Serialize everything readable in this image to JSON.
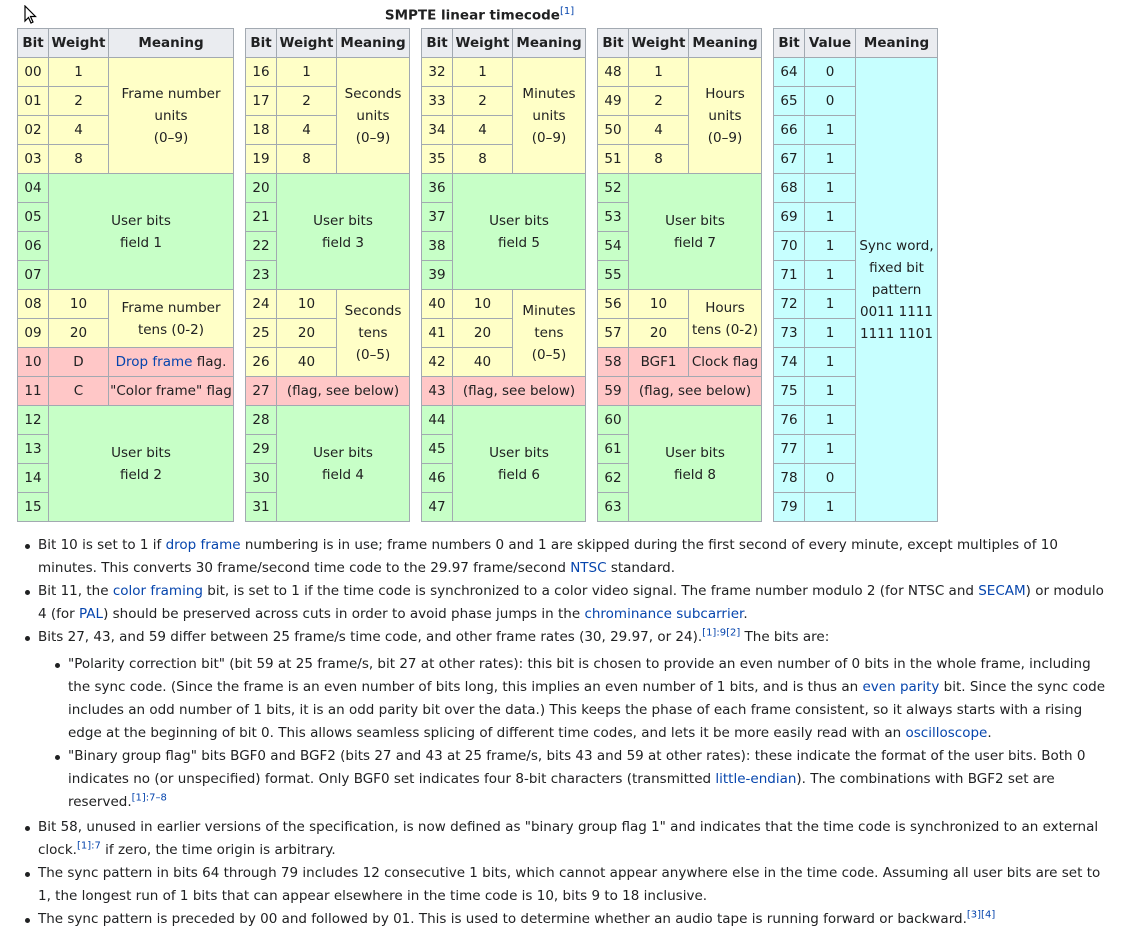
{
  "caption": {
    "title": "SMPTE linear timecode",
    "ref": "[1]"
  },
  "headers": {
    "bit": "Bit",
    "weight": "Weight",
    "meaning": "Meaning",
    "value": "Value"
  },
  "col1": {
    "bits": [
      "00",
      "01",
      "02",
      "03",
      "04",
      "05",
      "06",
      "07",
      "08",
      "09",
      "10",
      "11",
      "12",
      "13",
      "14",
      "15"
    ],
    "weights": [
      "1",
      "2",
      "4",
      "8",
      "10",
      "20",
      "D",
      "C"
    ],
    "frame_units": [
      "Frame number",
      "units",
      "(0–9)"
    ],
    "user1": [
      "User bits",
      "field 1"
    ],
    "frame_tens": [
      "Frame number",
      "tens (0-2)"
    ],
    "drop_link": "Drop frame",
    "drop_rest": " flag.",
    "color_flag": "\"Color frame\" flag",
    "user2": [
      "User bits",
      "field 2"
    ]
  },
  "col2": {
    "bits": [
      "16",
      "17",
      "18",
      "19",
      "20",
      "21",
      "22",
      "23",
      "24",
      "25",
      "26",
      "27",
      "28",
      "29",
      "30",
      "31"
    ],
    "weights": [
      "1",
      "2",
      "4",
      "8",
      "10",
      "20",
      "40"
    ],
    "sec_units": [
      "Seconds",
      "units",
      "(0–9)"
    ],
    "user3": [
      "User bits",
      "field 3"
    ],
    "sec_tens": [
      "Seconds",
      "tens",
      "(0–5)"
    ],
    "flag": "(flag, see below)",
    "user4": [
      "User bits",
      "field 4"
    ]
  },
  "col3": {
    "bits": [
      "32",
      "33",
      "34",
      "35",
      "36",
      "37",
      "38",
      "39",
      "40",
      "41",
      "42",
      "43",
      "44",
      "45",
      "46",
      "47"
    ],
    "weights": [
      "1",
      "2",
      "4",
      "8",
      "10",
      "20",
      "40"
    ],
    "min_units": [
      "Minutes",
      "units",
      "(0–9)"
    ],
    "user5": [
      "User bits",
      "field 5"
    ],
    "min_tens": [
      "Minutes",
      "tens",
      "(0–5)"
    ],
    "flag": "(flag, see below)",
    "user6": [
      "User bits",
      "field 6"
    ]
  },
  "col4": {
    "bits": [
      "48",
      "49",
      "50",
      "51",
      "52",
      "53",
      "54",
      "55",
      "56",
      "57",
      "58",
      "59",
      "60",
      "61",
      "62",
      "63"
    ],
    "weights": [
      "1",
      "2",
      "4",
      "8",
      "10",
      "20",
      "BGF1"
    ],
    "hour_units": [
      "Hours",
      "units",
      "(0–9)"
    ],
    "user7": [
      "User bits",
      "field 7"
    ],
    "hour_tens": [
      "Hours",
      "tens (0-2)"
    ],
    "clock_flag": "Clock flag",
    "flag": "(flag, see below)",
    "user8": [
      "User bits",
      "field 8"
    ]
  },
  "col5": {
    "bits": [
      "64",
      "65",
      "66",
      "67",
      "68",
      "69",
      "70",
      "71",
      "72",
      "73",
      "74",
      "75",
      "76",
      "77",
      "78",
      "79"
    ],
    "values": [
      "0",
      "0",
      "1",
      "1",
      "1",
      "1",
      "1",
      "1",
      "1",
      "1",
      "1",
      "1",
      "1",
      "1",
      "0",
      "1"
    ],
    "sync": [
      "Sync word,",
      "fixed bit",
      "pattern",
      "0011 1111",
      "1111 1101"
    ]
  },
  "notes": {
    "n1": {
      "a": "Bit 10 is set to 1 if ",
      "l1": "drop frame",
      "b": " numbering is in use; frame numbers 0 and 1 are skipped during the first second of every minute, except multiples of 10 minutes. This converts 30 frame/second time code to the 29.97 frame/second ",
      "l2": "NTSC",
      "c": " standard."
    },
    "n2": {
      "a": "Bit 11, the ",
      "l1": "color framing",
      "b": " bit, is set to 1 if the time code is synchronized to a color video signal. The frame number modulo 2 (for NTSC and ",
      "l2": "SECAM",
      "c": ") or modulo 4 (for ",
      "l3": "PAL",
      "d": ") should be preserved across cuts in order to avoid phase jumps in the ",
      "l4": "chrominance subcarrier",
      "e": "."
    },
    "n3": {
      "a": "Bits 27, 43, and 59 differ between 25 frame/s time code, and other frame rates (30, 29.97, or 24).",
      "s1": "[1]:9[2]",
      "b": " The bits are:"
    },
    "n3a": {
      "a": "\"Polarity correction bit\" (bit 59 at 25 frame/s, bit 27 at other rates): this bit is chosen to provide an even number of 0 bits in the whole frame, including the sync code. (Since the frame is an even number of bits long, this implies an even number of 1 bits, and is thus an ",
      "l1": "even parity",
      "b": " bit. Since the sync code includes an odd number of 1 bits, it is an odd parity bit over the data.) This keeps the phase of each frame consistent, so it always starts with a rising edge at the beginning of bit 0. This allows seamless splicing of different time codes, and lets it be more easily read with an ",
      "l2": "oscilloscope",
      "c": "."
    },
    "n3b": {
      "a": "\"Binary group flag\" bits BGF0 and BGF2 (bits 27 and 43 at 25 frame/s, bits 43 and 59 at other rates): these indicate the format of the user bits. Both 0 indicates no (or unspecified) format. Only BGF0 set indicates four 8-bit characters (transmitted ",
      "l1": "little-endian",
      "b": "). The combinations with BGF2 set are reserved.",
      "s1": "[1]:7–8"
    },
    "n4": {
      "a": "Bit 58, unused in earlier versions of the specification, is now defined as \"binary group flag 1\" and indicates that the time code is synchronized to an external clock.",
      "s1": "[1]:7",
      "b": " if zero, the time origin is arbitrary."
    },
    "n5": {
      "a": "The sync pattern in bits 64 through 79 includes 12 consecutive 1 bits, which cannot appear anywhere else in the time code. Assuming all user bits are set to 1, the longest run of 1 bits that can appear elsewhere in the time code is 10, bits 9 to 18 inclusive."
    },
    "n6": {
      "a": "The sync pattern is preceded by 00 and followed by 01. This is used to determine whether an audio tape is running forward or backward.",
      "s1": "[3][4]"
    }
  }
}
